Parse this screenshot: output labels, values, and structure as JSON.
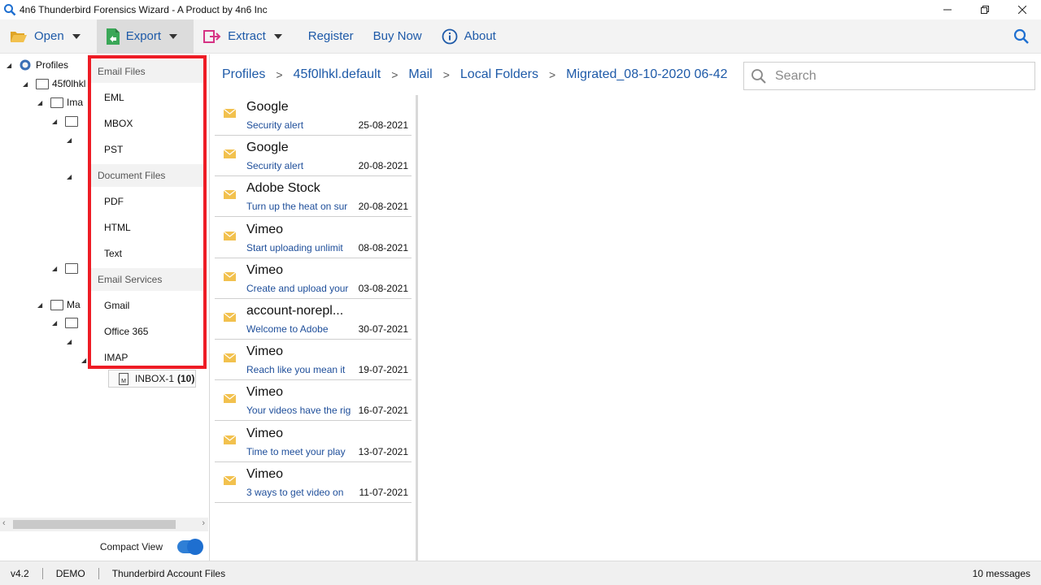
{
  "window": {
    "title": "4n6 Thunderbird Forensics Wizard - A Product by 4n6 Inc"
  },
  "toolbar": {
    "open_label": "Open",
    "export_label": "Export",
    "extract_label": "Extract",
    "register_label": "Register",
    "buynow_label": "Buy Now",
    "about_label": "About"
  },
  "tree": {
    "root_label": "Profiles",
    "profile_label": "45f0lhkl",
    "imap_label": "Ima",
    "mail_label": "Ma",
    "inbox_label": "INBOX-1",
    "inbox_count": "(10)"
  },
  "compact_view_label": "Compact View",
  "export_menu": {
    "email_files_header": "Email Files",
    "email_files": [
      "EML",
      "MBOX",
      "PST"
    ],
    "document_files_header": "Document Files",
    "document_files": [
      "PDF",
      "HTML",
      "Text"
    ],
    "email_services_header": "Email Services",
    "email_services": [
      "Gmail",
      "Office 365",
      "IMAP"
    ]
  },
  "breadcrumb": [
    "Profiles",
    "45f0lhkl.default",
    "Mail",
    "Local Folders",
    "Migrated_08-10-2020 06-42"
  ],
  "search": {
    "placeholder": "Search"
  },
  "mails": [
    {
      "sender": "Google",
      "subject": "Security alert",
      "date": "25-08-2021"
    },
    {
      "sender": "Google",
      "subject": "Security alert",
      "date": "20-08-2021"
    },
    {
      "sender": "Adobe Stock",
      "subject": "Turn up the heat on sur",
      "date": "20-08-2021"
    },
    {
      "sender": "Vimeo",
      "subject": "Start uploading unlimit",
      "date": "08-08-2021"
    },
    {
      "sender": "Vimeo",
      "subject": "Create and upload your",
      "date": "03-08-2021"
    },
    {
      "sender": "account-norepl...",
      "subject": "Welcome to Adobe",
      "date": "30-07-2021"
    },
    {
      "sender": "Vimeo",
      "subject": "Reach like you mean it",
      "date": "19-07-2021"
    },
    {
      "sender": "Vimeo",
      "subject": "Your videos have the rig",
      "date": "16-07-2021"
    },
    {
      "sender": "Vimeo",
      "subject": "Time to meet your play",
      "date": "13-07-2021"
    },
    {
      "sender": "Vimeo",
      "subject": "3 ways to get video on",
      "date": "11-07-2021"
    }
  ],
  "status": {
    "version": "v4.2",
    "mode": "DEMO",
    "account_type": "Thunderbird Account Files",
    "message_count": "10 messages"
  },
  "colors": {
    "accent_blue": "#1e5aa8",
    "highlight_red": "#ee1c25",
    "envelope_yellow": "#f2c14e"
  }
}
